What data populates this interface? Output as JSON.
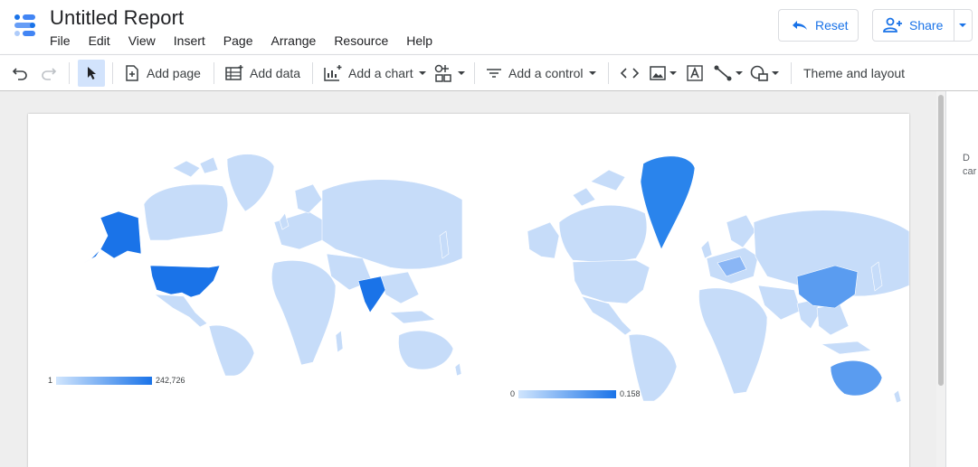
{
  "app": {
    "title": "Untitled Report",
    "menu": [
      "File",
      "Edit",
      "View",
      "Insert",
      "Page",
      "Arrange",
      "Resource",
      "Help"
    ],
    "reset_label": "Reset",
    "share_label": "Share",
    "accent_color": "#1a73e8"
  },
  "toolbar": {
    "add_page": "Add page",
    "add_data": "Add data",
    "add_chart": "Add a chart",
    "add_control": "Add a control",
    "theme_layout": "Theme and layout"
  },
  "maps": [
    {
      "legend_min": "1",
      "legend_max": "242,726",
      "highlight_regions": [
        "Alaska",
        "United States",
        "India"
      ]
    },
    {
      "legend_min": "0",
      "legend_max": "0.158",
      "highlight_regions": [
        "Greenland",
        "China",
        "Australia"
      ]
    }
  ],
  "side_panel": {
    "line1": "D",
    "line2": "car"
  },
  "colors": {
    "map_base": "#c6dcf9",
    "map_high": "#1a73e8",
    "map_mid": "#8ab6f5"
  }
}
